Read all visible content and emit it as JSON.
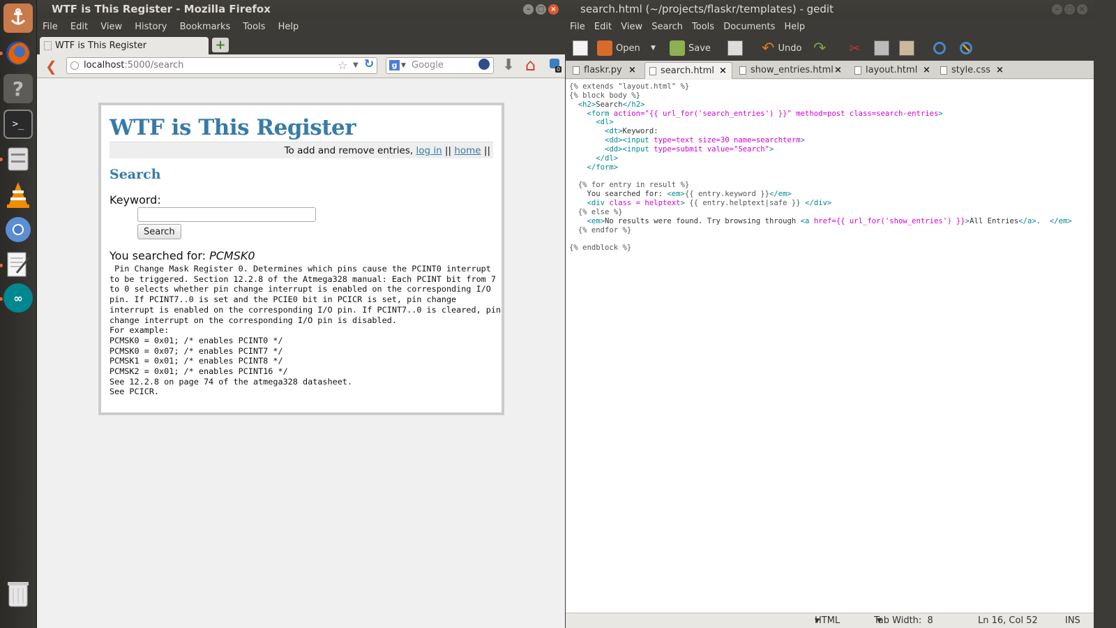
{
  "launcher": {
    "items": [
      "ubuntu-dash",
      "firefox",
      "help",
      "terminal",
      "files",
      "vlc",
      "chromium",
      "text-editor",
      "arduino",
      "trash"
    ]
  },
  "firefox": {
    "title": "WTF is This Register - Mozilla Firefox",
    "menu": [
      "File",
      "Edit",
      "View",
      "History",
      "Bookmarks",
      "Tools",
      "Help"
    ],
    "tab_title": "WTF is This Register",
    "url_host": "localhost",
    "url_rest": ":5000/search",
    "search_placeholder": "Google",
    "badge_count": "0",
    "page": {
      "heading": "WTF is This Register",
      "metanav_text": "To add and remove entries,",
      "login_link": "log in",
      "sep1": " || ",
      "home_link": "home",
      "sep2": " ||",
      "section_title": "Search",
      "keyword_label": "Keyword:",
      "keyword_value": "",
      "search_button": "Search",
      "searched_label": "You searched for: ",
      "searched_term": "PCMSK0",
      "helptext": [
        " Pin Change Mask Register 0. Determines which pins cause the PCINT0 interrupt",
        "to be triggered. Section 12.2.8 of the Atmega328 manual: Each PCINT bit from 7",
        "to 0 selects whether pin change interrupt is enabled on the corresponding I/O",
        "pin. If PCINT7..0 is set and the PCIE0 bit in PCICR is set, pin change",
        "interrupt is enabled on the corresponding I/O pin. If PCINT7..0 is cleared, pin",
        "change interrupt on the corresponding I/O pin is disabled.",
        "For example:",
        "PCMSK0 = 0x01; /* enables PCINT0 */",
        "PCMSK0 = 0x07; /* enables PCINT7 */",
        "PCMSK1 = 0x01; /* enables PCINT8 */",
        "PCMSK2 = 0x01; /* enables PCINT16 */",
        "See 12.2.8 on page 74 of the atmega328 datasheet.",
        "See PCICR."
      ]
    }
  },
  "gedit": {
    "title": "search.html (~/projects/flaskr/templates) - gedit",
    "menu": [
      "File",
      "Edit",
      "View",
      "Search",
      "Tools",
      "Documents",
      "Help"
    ],
    "toolbar": {
      "open": "Open",
      "save": "Save",
      "undo": "Undo"
    },
    "tabs": [
      "flaskr.py",
      "search.html",
      "show_entries.html",
      "layout.html",
      "style.css"
    ],
    "code_lines": [
      [
        [
          "j",
          "{% extends \"layout.html\" %}"
        ]
      ],
      [
        [
          "j",
          "{% block body %}"
        ]
      ],
      [
        [
          "p",
          "  "
        ],
        [
          "t",
          "<h2>"
        ],
        [
          "p",
          "Search"
        ],
        [
          "t",
          "</h2>"
        ]
      ],
      [
        [
          "p",
          "    "
        ],
        [
          "t",
          "<form "
        ],
        [
          "a",
          "action=\"{{ url_for('search_entries') }}\" method=post class=search-entries"
        ],
        [
          "t",
          ">"
        ]
      ],
      [
        [
          "p",
          "      "
        ],
        [
          "t",
          "<dl>"
        ]
      ],
      [
        [
          "p",
          "        "
        ],
        [
          "t",
          "<dt>"
        ],
        [
          "p",
          "Keyword:"
        ]
      ],
      [
        [
          "p",
          "        "
        ],
        [
          "t",
          "<dd><input "
        ],
        [
          "a",
          "type=text size=30 name=searchterm"
        ],
        [
          "t",
          ">"
        ]
      ],
      [
        [
          "p",
          "        "
        ],
        [
          "t",
          "<dd><input "
        ],
        [
          "a",
          "type=submit value=\"Search\""
        ],
        [
          "t",
          ">"
        ]
      ],
      [
        [
          "p",
          "      "
        ],
        [
          "t",
          "</dl>"
        ]
      ],
      [
        [
          "p",
          "    "
        ],
        [
          "t",
          "</form>"
        ]
      ],
      [
        [
          "p",
          ""
        ]
      ],
      [
        [
          "p",
          "  "
        ],
        [
          "j",
          "{% for entry in result %}"
        ]
      ],
      [
        [
          "p",
          "    You searched for: "
        ],
        [
          "t",
          "<em>"
        ],
        [
          "j",
          "{{ entry.keyword }}"
        ],
        [
          "t",
          "</em>"
        ]
      ],
      [
        [
          "p",
          "    "
        ],
        [
          "t",
          "<div "
        ],
        [
          "a",
          "class = helptext"
        ],
        [
          "t",
          ">"
        ],
        [
          "j",
          " {{ entry.helptext|safe }} "
        ],
        [
          "t",
          "</div>"
        ]
      ],
      [
        [
          "p",
          "  "
        ],
        [
          "j",
          "{% else %}"
        ]
      ],
      [
        [
          "p",
          "    "
        ],
        [
          "t",
          "<em>"
        ],
        [
          "p",
          "No results were found. Try browsing through "
        ],
        [
          "t",
          "<a "
        ],
        [
          "a",
          "href={{ url_for('show_entries') }}"
        ],
        [
          "t",
          ">"
        ],
        [
          "p",
          "All Entries"
        ],
        [
          "t",
          "</a>"
        ],
        [
          "p",
          ".  "
        ],
        [
          "t",
          "</em>"
        ]
      ],
      [
        [
          "p",
          "  "
        ],
        [
          "j",
          "{% endfor %}"
        ]
      ],
      [
        [
          "p",
          ""
        ]
      ],
      [
        [
          "j",
          "{% endblock %}"
        ]
      ]
    ],
    "status": {
      "language": "HTML",
      "tab_width": "Tab Width:  8",
      "position": "Ln 16, Col 52",
      "mode": "INS"
    }
  }
}
